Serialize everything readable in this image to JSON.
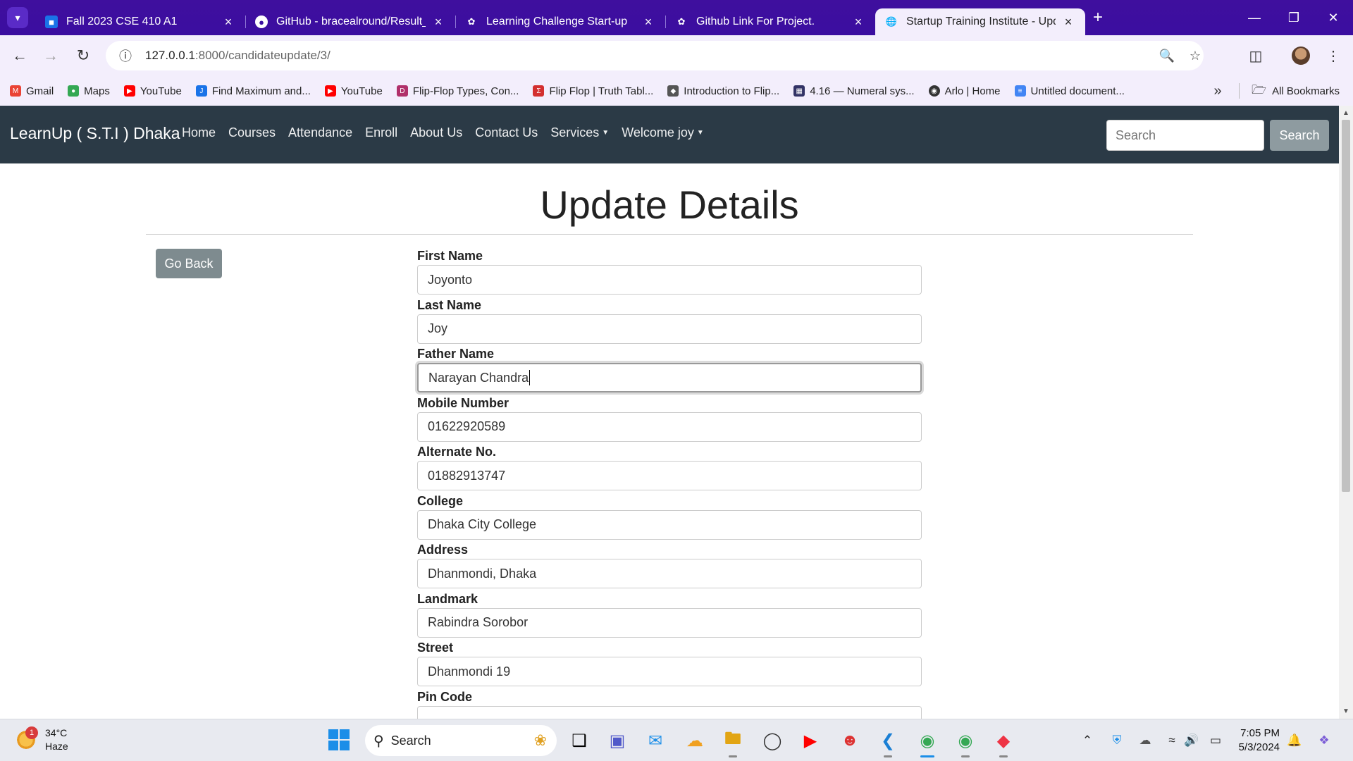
{
  "browser": {
    "tabs": [
      {
        "title": "Fall 2023 CSE 410 A1",
        "icon": "classroom-icon",
        "color": "#1a73e8"
      },
      {
        "title": "GitHub - bracealround/Result_P",
        "icon": "github-icon",
        "color": "#ffffff"
      },
      {
        "title": "Learning Challenge Start-up",
        "icon": "chatgpt-icon",
        "color": "#ffffff"
      },
      {
        "title": "Github Link For Project.",
        "icon": "chatgpt-icon",
        "color": "#ffffff"
      },
      {
        "title": "Startup Training Institute - Upd",
        "icon": "globe-icon",
        "color": "#666666",
        "active": true
      }
    ],
    "url_host": "127.0.0.1",
    "url_rest": ":8000/candidateupdate/3/",
    "bookmarks": [
      {
        "label": "Gmail",
        "color": "#ea4335"
      },
      {
        "label": "Maps",
        "color": "#34a853"
      },
      {
        "label": "YouTube",
        "color": "#ff0000"
      },
      {
        "label": "Find Maximum and...",
        "color": "#1a73e8"
      },
      {
        "label": "YouTube",
        "color": "#ff0000"
      },
      {
        "label": "Flip-Flop Types, Con...",
        "color": "#b0306a"
      },
      {
        "label": "Flip Flop | Truth Tabl...",
        "color": "#d32f2f"
      },
      {
        "label": "Introduction to Flip...",
        "color": "#555555"
      },
      {
        "label": "4.16 — Numeral sys...",
        "color": "#333366"
      },
      {
        "label": "Arlo | Home",
        "color": "#333333"
      },
      {
        "label": "Untitled document...",
        "color": "#4285f4"
      }
    ],
    "all_bookmarks": "All Bookmarks"
  },
  "site": {
    "brand": "LearnUp ( S.T.I ) Dhaka",
    "nav": [
      "Home",
      "Courses",
      "Attendance",
      "Enroll",
      "About Us",
      "Contact Us"
    ],
    "services": "Services",
    "welcome": "Welcome joy",
    "search_placeholder": "Search",
    "search_button": "Search"
  },
  "page": {
    "title": "Update Details",
    "go_back": "Go Back",
    "fields": [
      {
        "label": "First Name",
        "value": "Joyonto"
      },
      {
        "label": "Last Name",
        "value": "Joy"
      },
      {
        "label": "Father Name",
        "value": "Narayan Chandra",
        "focused": true
      },
      {
        "label": "Mobile Number",
        "value": "01622920589"
      },
      {
        "label": "Alternate No.",
        "value": "01882913747"
      },
      {
        "label": "College",
        "value": "Dhaka City College"
      },
      {
        "label": "Address",
        "value": "Dhanmondi, Dhaka"
      },
      {
        "label": "Landmark",
        "value": "Rabindra Sorobor"
      },
      {
        "label": "Street",
        "value": "Dhanmondi 19"
      },
      {
        "label": "Pin Code",
        "value": ""
      }
    ]
  },
  "taskbar": {
    "weather_temp": "34°C",
    "weather_desc": "Haze",
    "weather_badge": "1",
    "search_label": "Search",
    "time": "7:05 PM",
    "date": "5/3/2024"
  }
}
